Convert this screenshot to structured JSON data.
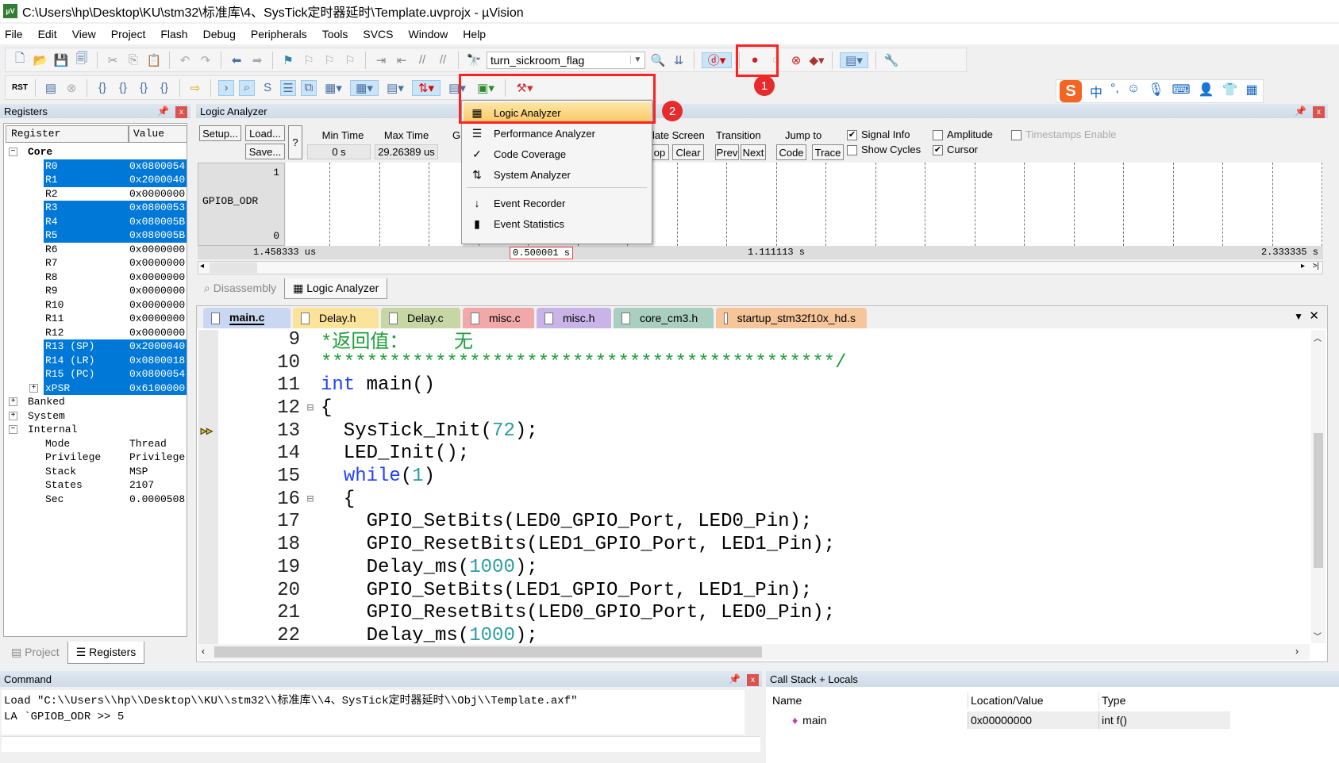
{
  "window": {
    "title": "C:\\Users\\hp\\Desktop\\KU\\stm32\\标准库\\4、SysTick定时器延时\\Template.uvprojx - µVision",
    "logo": "µV"
  },
  "menu": [
    "File",
    "Edit",
    "View",
    "Project",
    "Flash",
    "Debug",
    "Peripherals",
    "Tools",
    "SVCS",
    "Window",
    "Help"
  ],
  "toolbar": {
    "target_combo": "turn_sickroom_flag",
    "rst_label": "RST"
  },
  "registers": {
    "title": "Registers",
    "col_register": "Register",
    "col_value": "Value",
    "rows": [
      {
        "name": "Core",
        "value": "",
        "level": 0,
        "expander": "−",
        "bold": true,
        "sel": false
      },
      {
        "name": "R0",
        "value": "0x0800054",
        "level": 2,
        "sel": true
      },
      {
        "name": "R1",
        "value": "0x2000040",
        "level": 2,
        "sel": true
      },
      {
        "name": "R2",
        "value": "0x0000000",
        "level": 2,
        "sel": false
      },
      {
        "name": "R3",
        "value": "0x0800053",
        "level": 2,
        "sel": true
      },
      {
        "name": "R4",
        "value": "0x080005B",
        "level": 2,
        "sel": true
      },
      {
        "name": "R5",
        "value": "0x080005B",
        "level": 2,
        "sel": true
      },
      {
        "name": "R6",
        "value": "0x0000000",
        "level": 2,
        "sel": false
      },
      {
        "name": "R7",
        "value": "0x0000000",
        "level": 2,
        "sel": false
      },
      {
        "name": "R8",
        "value": "0x0000000",
        "level": 2,
        "sel": false
      },
      {
        "name": "R9",
        "value": "0x0000000",
        "level": 2,
        "sel": false
      },
      {
        "name": "R10",
        "value": "0x0000000",
        "level": 2,
        "sel": false
      },
      {
        "name": "R11",
        "value": "0x0000000",
        "level": 2,
        "sel": false
      },
      {
        "name": "R12",
        "value": "0x0000000",
        "level": 2,
        "sel": false
      },
      {
        "name": "R13 (SP)",
        "value": "0x2000040",
        "level": 2,
        "sel": true
      },
      {
        "name": "R14 (LR)",
        "value": "0x0800018",
        "level": 2,
        "sel": true
      },
      {
        "name": "R15 (PC)",
        "value": "0x0800054",
        "level": 2,
        "sel": true
      },
      {
        "name": "xPSR",
        "value": "0x6100000",
        "level": 2,
        "sel": true,
        "expander": "+"
      },
      {
        "name": "Banked",
        "value": "",
        "level": 0,
        "expander": "+",
        "sel": false
      },
      {
        "name": "System",
        "value": "",
        "level": 0,
        "expander": "+",
        "sel": false
      },
      {
        "name": "Internal",
        "value": "",
        "level": 0,
        "expander": "−",
        "sel": false
      },
      {
        "name": "Mode",
        "value": "Thread",
        "level": 2,
        "sel": false
      },
      {
        "name": "Privilege",
        "value": "Privilege",
        "level": 2,
        "sel": false
      },
      {
        "name": "Stack",
        "value": "MSP",
        "level": 2,
        "sel": false
      },
      {
        "name": "States",
        "value": "2107",
        "level": 2,
        "sel": false
      },
      {
        "name": "Sec",
        "value": "0.0000508",
        "level": 2,
        "sel": false
      }
    ],
    "tabs": [
      {
        "label": "Project",
        "active": false
      },
      {
        "label": "Registers",
        "active": true
      }
    ]
  },
  "logic_analyzer": {
    "title": "Logic Analyzer",
    "setup": "Setup...",
    "load": "Load...",
    "save": "Save...",
    "help": "?",
    "min_time_label": "Min Time",
    "min_time": "0 s",
    "max_time_label": "Max Time",
    "max_time": "29.26389 us",
    "grid_label_partial": "G",
    "update_screen_label": "late Screen",
    "stop_partial": "op",
    "clear": "Clear",
    "transition_label": "Transition",
    "prev": "Prev",
    "next": "Next",
    "jump_to_label": "Jump to",
    "code": "Code",
    "trace": "Trace",
    "checks": [
      {
        "label": "Signal Info",
        "checked": true
      },
      {
        "label": "Amplitude",
        "checked": false
      },
      {
        "label": "Timestamps Enable",
        "checked": false,
        "disabled": true
      },
      {
        "label": "Show Cycles",
        "checked": false
      },
      {
        "label": "Cursor",
        "checked": true
      }
    ],
    "signal": "GPIOB_ODR",
    "y_max": "1",
    "y_min": "0",
    "time_left": "1.458333 us",
    "time_cursor": "0.500001 s",
    "time_mid": "1.111113 s",
    "time_right": "2.333335 s"
  },
  "view_tabs": [
    {
      "label": "Disassembly",
      "active": false
    },
    {
      "label": "Logic Analyzer",
      "active": true
    }
  ],
  "editor": {
    "tabs": [
      {
        "label": "main.c",
        "color": "#c9d7f0",
        "active": true
      },
      {
        "label": "Delay.h",
        "color": "#fbe39a"
      },
      {
        "label": "Delay.c",
        "color": "#c8d6a6"
      },
      {
        "label": "misc.c",
        "color": "#f0a8a8"
      },
      {
        "label": "misc.h",
        "color": "#c8b4e6"
      },
      {
        "label": "core_cm3.h",
        "color": "#a9cfc0"
      },
      {
        "label": "startup_stm32f10x_hd.s",
        "color": "#f7c59a"
      }
    ],
    "lines": [
      {
        "n": "9",
        "t": [
          [
            "*返回值：    无",
            "cm"
          ]
        ]
      },
      {
        "n": "10",
        "t": [
          [
            "*********************************************/",
            "cm"
          ]
        ]
      },
      {
        "n": "11",
        "t": [
          [
            "int",
            "kw"
          ],
          [
            " main()",
            ""
          ]
        ]
      },
      {
        "n": "12",
        "t": [
          [
            "{",
            ""
          ]
        ],
        "fold": true
      },
      {
        "n": "13",
        "t": [
          [
            "  SysTick_Init(",
            ""
          ],
          [
            "72",
            "num"
          ],
          [
            ");",
            ""
          ]
        ],
        "current": true
      },
      {
        "n": "14",
        "t": [
          [
            "  LED_Init();",
            ""
          ]
        ]
      },
      {
        "n": "15",
        "t": [
          [
            "  ",
            ""
          ],
          [
            "while",
            "kw"
          ],
          [
            "(",
            ""
          ],
          [
            "1",
            "num"
          ],
          [
            ")",
            ""
          ]
        ]
      },
      {
        "n": "16",
        "t": [
          [
            "  {",
            ""
          ]
        ],
        "fold": true
      },
      {
        "n": "17",
        "t": [
          [
            "    GPIO_SetBits(LED0_GPIO_Port, LED0_Pin);",
            ""
          ]
        ]
      },
      {
        "n": "18",
        "t": [
          [
            "    GPIO_ResetBits(LED1_GPIO_Port, LED1_Pin);",
            ""
          ]
        ]
      },
      {
        "n": "19",
        "t": [
          [
            "    Delay_ms(",
            ""
          ],
          [
            "1000",
            "num"
          ],
          [
            ");",
            ""
          ]
        ]
      },
      {
        "n": "20",
        "t": [
          [
            "    GPIO_SetBits(LED1_GPIO_Port, LED1_Pin);",
            ""
          ]
        ]
      },
      {
        "n": "21",
        "t": [
          [
            "    GPIO_ResetBits(LED0_GPIO_Port, LED0_Pin);",
            ""
          ]
        ]
      },
      {
        "n": "22",
        "t": [
          [
            "    Delay_ms(",
            ""
          ],
          [
            "1000",
            "num"
          ],
          [
            ");",
            ""
          ]
        ]
      }
    ]
  },
  "dropdown": {
    "items": [
      {
        "label": "Logic Analyzer",
        "icon": "logic-analyzer-icon",
        "glyph": "▦",
        "highlighted": true
      },
      {
        "label": "Performance Analyzer",
        "icon": "performance-analyzer-icon",
        "glyph": "☰"
      },
      {
        "label": "Code Coverage",
        "icon": "code-coverage-icon",
        "glyph": "✓"
      },
      {
        "label": "System Analyzer",
        "icon": "system-analyzer-icon",
        "glyph": "⇅"
      },
      {
        "label": "Event Recorder",
        "icon": "event-recorder-icon",
        "glyph": "↓"
      },
      {
        "label": "Event Statistics",
        "icon": "event-statistics-icon",
        "glyph": "▮"
      }
    ]
  },
  "annotations": {
    "badge1": "1",
    "badge2": "2",
    "color": "#e52b2b"
  },
  "command": {
    "title": "Command",
    "lines": [
      "Load \"C:\\\\Users\\\\hp\\\\Desktop\\\\KU\\\\stm32\\\\标准库\\\\4、SysTick定时器延时\\\\Obj\\\\Template.axf\"",
      "LA `GPIOB_ODR >> 5"
    ]
  },
  "callstack": {
    "title": "Call Stack + Locals",
    "cols": [
      "Name",
      "Location/Value",
      "Type"
    ],
    "rows": [
      [
        "main",
        "0x00000000",
        "int f()"
      ]
    ]
  },
  "ime": {
    "logo": "S",
    "items": [
      "中",
      "°,",
      "☺",
      "🎙",
      "⌨",
      "👤",
      "👕",
      "▦"
    ]
  },
  "colors": {
    "selection": "#0078d7",
    "accent_red": "#e52b2b",
    "menu_highlight": "#fbd27a"
  }
}
